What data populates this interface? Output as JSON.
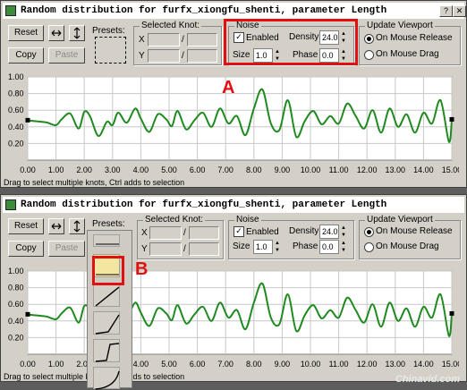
{
  "windows": [
    {
      "title": "Random distribution for furfx_xiongfu_shenti, parameter Length",
      "buttons": {
        "reset": "Reset",
        "copy": "Copy",
        "paste": "Paste"
      },
      "presets_label": "Presets:",
      "selected_knot": {
        "title": "Selected Knot:",
        "x_label": "X",
        "y_label": "Y",
        "slash": "/"
      },
      "noise": {
        "title": "Noise",
        "enabled_label": "Enabled",
        "enabled_mark": "✓",
        "density_label": "Density",
        "density": "24.0",
        "size_label": "Size",
        "size": "1.0",
        "phase_label": "Phase",
        "phase": "0.0"
      },
      "update": {
        "title": "Update Viewport",
        "option1": "On Mouse Release",
        "option2": "On Mouse Drag"
      },
      "status": "Drag to select multiple knots, Ctrl adds to selection"
    },
    {
      "title": "Random distribution for furfx_xiongfu_shenti, parameter Length",
      "buttons": {
        "reset": "Reset",
        "copy": "Copy",
        "paste": "Paste"
      },
      "presets_label": "Presets:",
      "selected_knot": {
        "title": "Selected Knot:",
        "x_label": "X",
        "y_label": "Y",
        "slash": "/"
      },
      "noise": {
        "title": "Noise",
        "enabled_label": "Enabled",
        "enabled_mark": "✓",
        "density_label": "Density",
        "density": "24.0",
        "size_label": "Size",
        "size": "1.0",
        "phase_label": "Phase",
        "phase": "0.0"
      },
      "update": {
        "title": "Update Viewport",
        "option1": "On Mouse Release",
        "option2": "On Mouse Drag"
      },
      "status": "Drag to select multiple knots, Ctrl adds to selection"
    }
  ],
  "annotations": {
    "a": "A",
    "b": "B"
  },
  "watermark": "Chinavid.com",
  "icons": {
    "close": "close-icon",
    "help": "help-icon",
    "h_arrows": "horizontal-arrows-icon",
    "v_arrows": "vertical-arrows-icon"
  },
  "colors": {
    "curve": "#1f8a1f",
    "annotation": "#e01010",
    "graph_bg": "#ffffff"
  },
  "chart_data": {
    "type": "line",
    "x_ticks": [
      "0.00",
      "1.00",
      "2.00",
      "3.00",
      "4.00",
      "5.00",
      "6.00",
      "7.00",
      "8.00",
      "9.00",
      "10.00",
      "11.00",
      "12.00",
      "13.00",
      "14.00",
      "15.00"
    ],
    "y_ticks": [
      "1.00",
      "0.80",
      "0.60",
      "0.40",
      "0.20"
    ],
    "xlim": [
      0,
      15
    ],
    "ylim": [
      0,
      1
    ],
    "grid": true,
    "x": [
      0,
      0.2,
      0.5,
      0.7,
      1.0,
      1.2,
      1.5,
      1.8,
      2.0,
      2.2,
      2.5,
      2.8,
      3.0,
      3.2,
      3.5,
      3.8,
      4.0,
      4.3,
      4.6,
      4.9,
      5.1,
      5.3,
      5.6,
      5.9,
      6.2,
      6.5,
      6.8,
      7.1,
      7.4,
      7.7,
      8.0,
      8.3,
      8.6,
      8.9,
      9.2,
      9.5,
      9.8,
      10.1,
      10.4,
      10.7,
      11.0,
      11.3,
      11.6,
      11.9,
      12.2,
      12.5,
      12.8,
      13.1,
      13.4,
      13.7,
      14.0,
      14.3,
      14.6,
      14.9,
      15.0
    ],
    "y": [
      0.48,
      0.47,
      0.46,
      0.45,
      0.42,
      0.49,
      0.56,
      0.38,
      0.58,
      0.53,
      0.29,
      0.46,
      0.42,
      0.57,
      0.45,
      0.62,
      0.5,
      0.34,
      0.55,
      0.49,
      0.41,
      0.59,
      0.37,
      0.48,
      0.57,
      0.4,
      0.62,
      0.44,
      0.53,
      0.3,
      0.62,
      0.85,
      0.44,
      0.36,
      0.72,
      0.28,
      0.47,
      0.59,
      0.43,
      0.53,
      0.44,
      0.68,
      0.53,
      0.38,
      0.6,
      0.33,
      0.62,
      0.4,
      0.55,
      0.33,
      0.57,
      0.44,
      0.72,
      0.22,
      0.49
    ]
  }
}
